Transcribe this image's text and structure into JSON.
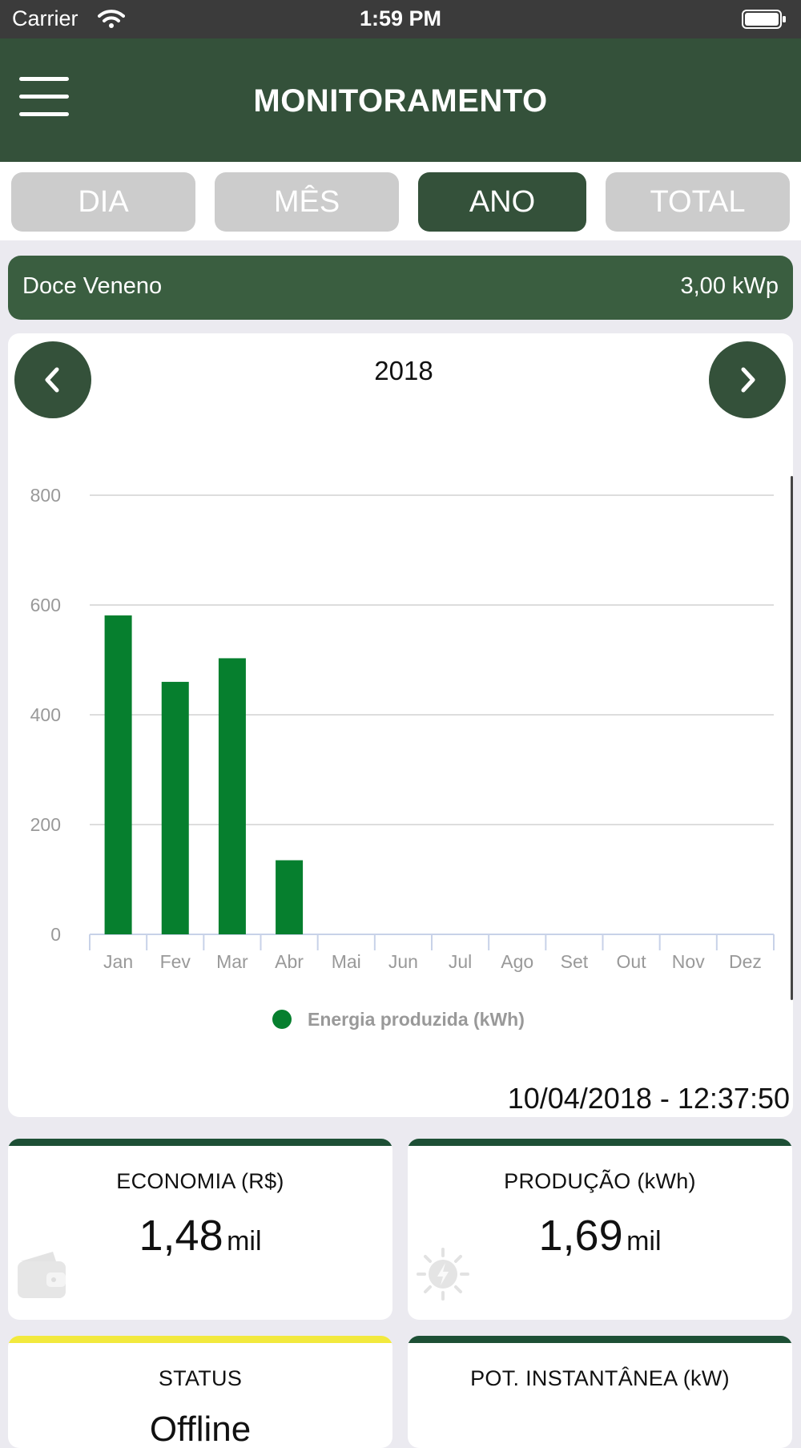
{
  "status_bar": {
    "carrier": "Carrier",
    "time": "1:59 PM"
  },
  "header": {
    "title": "MONITORAMENTO"
  },
  "tabs": [
    {
      "label": "DIA",
      "active": false
    },
    {
      "label": "MÊS",
      "active": false
    },
    {
      "label": "ANO",
      "active": true
    },
    {
      "label": "TOTAL",
      "active": false
    }
  ],
  "plant": {
    "name": "Doce Veneno",
    "power": "3,00 kWp"
  },
  "chart_header": {
    "year": "2018"
  },
  "chart_data": {
    "type": "bar",
    "categories": [
      "Jan",
      "Fev",
      "Mar",
      "Abr",
      "Mai",
      "Jun",
      "Jul",
      "Ago",
      "Set",
      "Out",
      "Nov",
      "Dez"
    ],
    "series": [
      {
        "name": "Energia produzida (kWh)",
        "values": [
          581,
          460,
          503,
          135,
          0,
          0,
          0,
          0,
          0,
          0,
          0,
          0
        ]
      }
    ],
    "yticks": [
      "0",
      "200",
      "400",
      "600",
      "800"
    ],
    "ylim": [
      0,
      800
    ],
    "grid": true,
    "legend": "bottom-center",
    "colors": {
      "bar": "#067f2e",
      "grid": "#dddddd",
      "axis": "#c8d2e8",
      "tick_text": "#999999"
    }
  },
  "chart_footer": {
    "timestamp": "10/04/2018 - 12:37:50"
  },
  "cards": {
    "economia": {
      "label": "ECONOMIA (R$)",
      "value": "1,48",
      "unit": "mil",
      "icon": "wallet-icon",
      "accent": "#1d4f35"
    },
    "producao": {
      "label": "PRODUÇÃO (kWh)",
      "value": "1,69",
      "unit": "mil",
      "icon": "sun-bolt-icon",
      "accent": "#1d4f35"
    },
    "status": {
      "label": "STATUS",
      "value": "Offline",
      "accent": "#f2e93d"
    },
    "pot": {
      "label": "POT. INSTANTÂNEA (kW)",
      "accent": "#1d4f35"
    }
  },
  "colors": {
    "brand": "#34513a",
    "plant_bar": "#3a5e40",
    "tab_inactive": "#cccccc",
    "background": "#ebeaf0"
  }
}
